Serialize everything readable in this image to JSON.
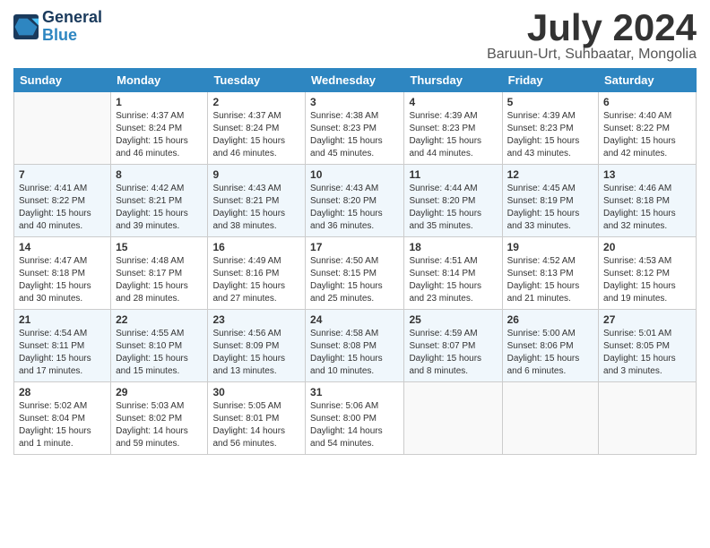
{
  "header": {
    "logo_line1": "General",
    "logo_line2": "Blue",
    "title": "July 2024",
    "subtitle": "Baruun-Urt, Suhbaatar, Mongolia"
  },
  "weekdays": [
    "Sunday",
    "Monday",
    "Tuesday",
    "Wednesday",
    "Thursday",
    "Friday",
    "Saturday"
  ],
  "weeks": [
    [
      {
        "day": "",
        "content": ""
      },
      {
        "day": "1",
        "content": "Sunrise: 4:37 AM\nSunset: 8:24 PM\nDaylight: 15 hours\nand 46 minutes."
      },
      {
        "day": "2",
        "content": "Sunrise: 4:37 AM\nSunset: 8:24 PM\nDaylight: 15 hours\nand 46 minutes."
      },
      {
        "day": "3",
        "content": "Sunrise: 4:38 AM\nSunset: 8:23 PM\nDaylight: 15 hours\nand 45 minutes."
      },
      {
        "day": "4",
        "content": "Sunrise: 4:39 AM\nSunset: 8:23 PM\nDaylight: 15 hours\nand 44 minutes."
      },
      {
        "day": "5",
        "content": "Sunrise: 4:39 AM\nSunset: 8:23 PM\nDaylight: 15 hours\nand 43 minutes."
      },
      {
        "day": "6",
        "content": "Sunrise: 4:40 AM\nSunset: 8:22 PM\nDaylight: 15 hours\nand 42 minutes."
      }
    ],
    [
      {
        "day": "7",
        "content": "Sunrise: 4:41 AM\nSunset: 8:22 PM\nDaylight: 15 hours\nand 40 minutes."
      },
      {
        "day": "8",
        "content": "Sunrise: 4:42 AM\nSunset: 8:21 PM\nDaylight: 15 hours\nand 39 minutes."
      },
      {
        "day": "9",
        "content": "Sunrise: 4:43 AM\nSunset: 8:21 PM\nDaylight: 15 hours\nand 38 minutes."
      },
      {
        "day": "10",
        "content": "Sunrise: 4:43 AM\nSunset: 8:20 PM\nDaylight: 15 hours\nand 36 minutes."
      },
      {
        "day": "11",
        "content": "Sunrise: 4:44 AM\nSunset: 8:20 PM\nDaylight: 15 hours\nand 35 minutes."
      },
      {
        "day": "12",
        "content": "Sunrise: 4:45 AM\nSunset: 8:19 PM\nDaylight: 15 hours\nand 33 minutes."
      },
      {
        "day": "13",
        "content": "Sunrise: 4:46 AM\nSunset: 8:18 PM\nDaylight: 15 hours\nand 32 minutes."
      }
    ],
    [
      {
        "day": "14",
        "content": "Sunrise: 4:47 AM\nSunset: 8:18 PM\nDaylight: 15 hours\nand 30 minutes."
      },
      {
        "day": "15",
        "content": "Sunrise: 4:48 AM\nSunset: 8:17 PM\nDaylight: 15 hours\nand 28 minutes."
      },
      {
        "day": "16",
        "content": "Sunrise: 4:49 AM\nSunset: 8:16 PM\nDaylight: 15 hours\nand 27 minutes."
      },
      {
        "day": "17",
        "content": "Sunrise: 4:50 AM\nSunset: 8:15 PM\nDaylight: 15 hours\nand 25 minutes."
      },
      {
        "day": "18",
        "content": "Sunrise: 4:51 AM\nSunset: 8:14 PM\nDaylight: 15 hours\nand 23 minutes."
      },
      {
        "day": "19",
        "content": "Sunrise: 4:52 AM\nSunset: 8:13 PM\nDaylight: 15 hours\nand 21 minutes."
      },
      {
        "day": "20",
        "content": "Sunrise: 4:53 AM\nSunset: 8:12 PM\nDaylight: 15 hours\nand 19 minutes."
      }
    ],
    [
      {
        "day": "21",
        "content": "Sunrise: 4:54 AM\nSunset: 8:11 PM\nDaylight: 15 hours\nand 17 minutes."
      },
      {
        "day": "22",
        "content": "Sunrise: 4:55 AM\nSunset: 8:10 PM\nDaylight: 15 hours\nand 15 minutes."
      },
      {
        "day": "23",
        "content": "Sunrise: 4:56 AM\nSunset: 8:09 PM\nDaylight: 15 hours\nand 13 minutes."
      },
      {
        "day": "24",
        "content": "Sunrise: 4:58 AM\nSunset: 8:08 PM\nDaylight: 15 hours\nand 10 minutes."
      },
      {
        "day": "25",
        "content": "Sunrise: 4:59 AM\nSunset: 8:07 PM\nDaylight: 15 hours\nand 8 minutes."
      },
      {
        "day": "26",
        "content": "Sunrise: 5:00 AM\nSunset: 8:06 PM\nDaylight: 15 hours\nand 6 minutes."
      },
      {
        "day": "27",
        "content": "Sunrise: 5:01 AM\nSunset: 8:05 PM\nDaylight: 15 hours\nand 3 minutes."
      }
    ],
    [
      {
        "day": "28",
        "content": "Sunrise: 5:02 AM\nSunset: 8:04 PM\nDaylight: 15 hours\nand 1 minute."
      },
      {
        "day": "29",
        "content": "Sunrise: 5:03 AM\nSunset: 8:02 PM\nDaylight: 14 hours\nand 59 minutes."
      },
      {
        "day": "30",
        "content": "Sunrise: 5:05 AM\nSunset: 8:01 PM\nDaylight: 14 hours\nand 56 minutes."
      },
      {
        "day": "31",
        "content": "Sunrise: 5:06 AM\nSunset: 8:00 PM\nDaylight: 14 hours\nand 54 minutes."
      },
      {
        "day": "",
        "content": ""
      },
      {
        "day": "",
        "content": ""
      },
      {
        "day": "",
        "content": ""
      }
    ]
  ]
}
